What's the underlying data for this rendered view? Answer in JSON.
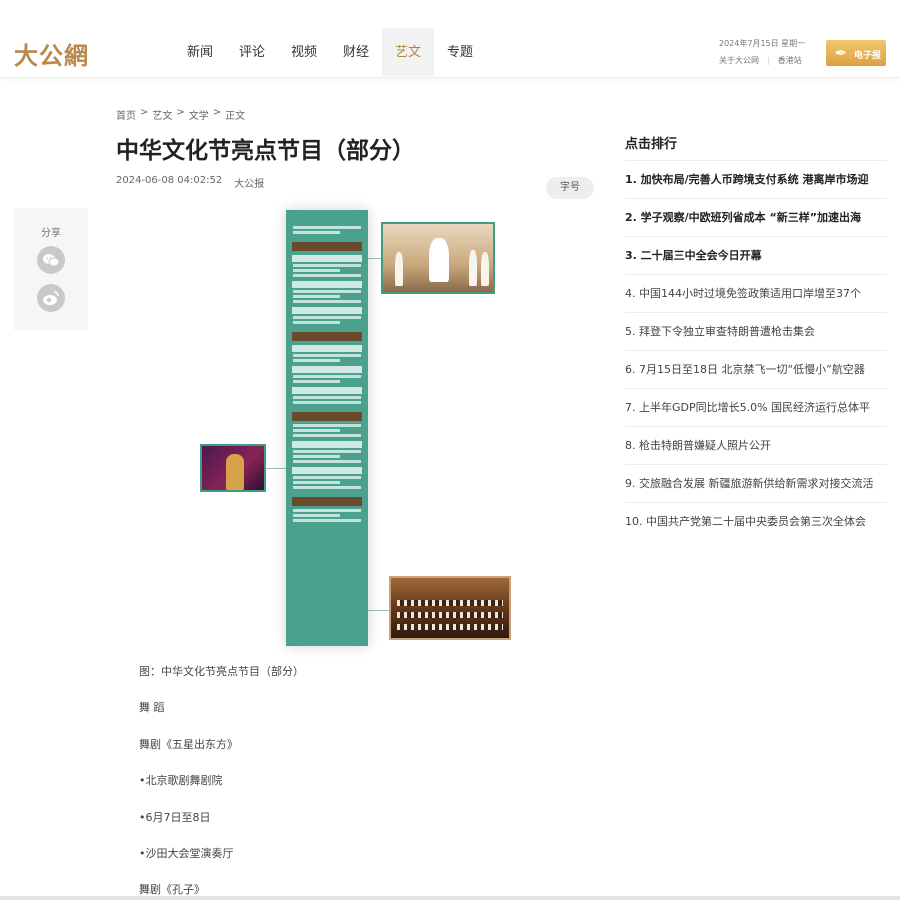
{
  "header": {
    "logo": "大公網",
    "nav": [
      "新闻",
      "评论",
      "视频",
      "财经",
      "艺文",
      "专题"
    ],
    "active_nav": "艺文",
    "date": "2024年7月15日 星期一",
    "links": [
      "关于大公网",
      "香港站"
    ],
    "epaper_label": "电子报"
  },
  "breadcrumb": [
    "首页",
    ">",
    "艺文",
    ">",
    "文学",
    ">",
    "正文"
  ],
  "article": {
    "title": "中华文化节亮点节目（部分）",
    "datetime": "2024-06-08 04:02:52",
    "source": "大公报",
    "font_size_button": "字号",
    "caption": "图：中华文化节亮点节目（部分）",
    "paragraphs": [
      "舞 蹈",
      "舞剧《五星出东方》",
      "•北京歌剧舞剧院",
      "•6月7日至8日",
      "•沙田大会堂演奏厅",
      "舞剧《孔子》"
    ]
  },
  "share": {
    "label": "分享"
  },
  "ranking": {
    "title": "点击排行",
    "items": [
      "1. 加快布局/完善人币跨境支付系统 港离岸市场迎",
      "2. 学子观察/中欧班列省成本 “新三样”加速出海",
      "3. 二十届三中全会今日开幕",
      "4. 中国144小时过境免签政策适用口岸增至37个",
      "5. 拜登下令独立审查特朗普遭枪击集会",
      "6. 7月15日至18日 北京禁飞一切“低慢小”航空器",
      "7. 上半年GDP同比增长5.0% 国民经济运行总体平",
      "8. 枪击特朗普嫌疑人照片公开",
      "9. 交旅融合发展 新疆旅游新供给新需求对接交流活",
      "10. 中国共产党第二十届中央委员会第三次全体会"
    ]
  }
}
